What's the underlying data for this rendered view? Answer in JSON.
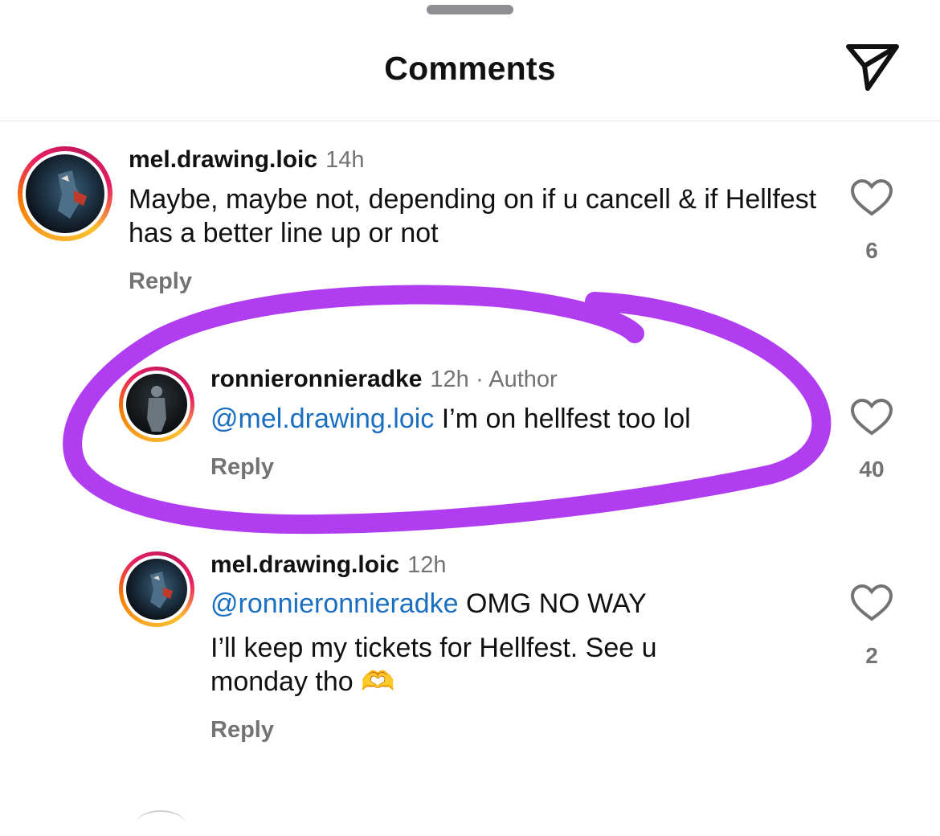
{
  "header": {
    "title": "Comments",
    "share_icon": "paper-plane-icon"
  },
  "annotation": {
    "color": "#b03ef0"
  },
  "comments": [
    {
      "username": "mel.drawing.loic",
      "time": "14h",
      "text": "Maybe, maybe not, depending on if u cancell & if Hellfest has a better line up or not",
      "reply": "Reply",
      "likes": "6"
    },
    {
      "username": "ronnieronnieradke",
      "time": "12h",
      "badge": "· Author",
      "mention": "@mel.drawing.loic",
      "text": " I’m on hellfest too lol",
      "reply": "Reply",
      "likes": "40"
    },
    {
      "username": "mel.drawing.loic",
      "time": "12h",
      "mention": "@ronnieronnieradke",
      "text_line1": " OMG NO WAY",
      "text_line2": "I’ll keep my tickets for Hellfest. See u monday tho 🫶",
      "reply": "Reply",
      "likes": "2"
    }
  ]
}
